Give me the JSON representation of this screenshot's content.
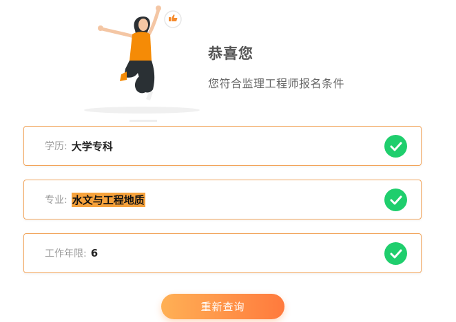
{
  "result": {
    "title": "恭喜您",
    "subtitle": "您符合监理工程师报名条件"
  },
  "items": [
    {
      "label": "学历:",
      "value": "大学专科",
      "highlight": false,
      "status": "check-circle-icon"
    },
    {
      "label": "专业:",
      "value": "水文与工程地质",
      "highlight": true,
      "status": "check-circle-icon"
    },
    {
      "label": "工作年限:",
      "value": "6",
      "highlight": false,
      "status": "check-circle-icon"
    }
  ],
  "actions": {
    "requery_label": "重新查询"
  },
  "colors": {
    "accent": "#ff8a3d",
    "card_border": "#f2a45a",
    "success": "#1fce6d",
    "highlight_bg": "#f6a23c"
  },
  "illustration": {
    "icon": "jumping-celebration-illustration",
    "badge_icon": "thumbs-up-icon"
  }
}
